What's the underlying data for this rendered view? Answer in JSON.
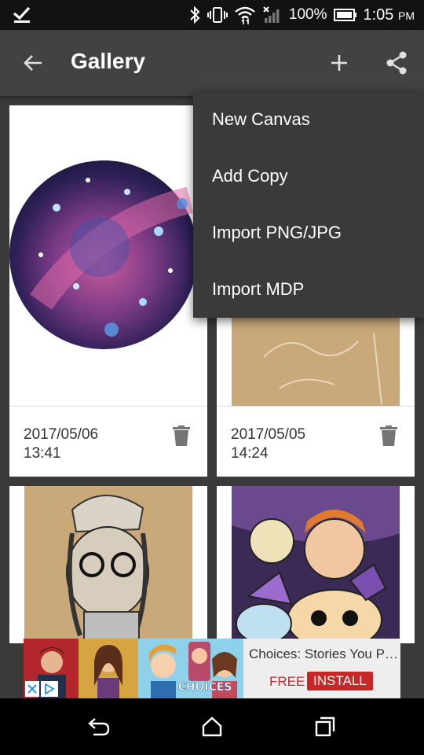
{
  "status_bar": {
    "battery": "100%",
    "time": "1:05",
    "ampm": "PM"
  },
  "app_bar": {
    "title": "Gallery"
  },
  "gallery": {
    "cards": [
      {
        "date": "2017/05/06",
        "time": "13:41"
      },
      {
        "date": "2017/05/05",
        "time": "14:24"
      },
      {
        "date": "",
        "time": ""
      },
      {
        "date": "",
        "time": ""
      }
    ]
  },
  "menu": {
    "items": [
      {
        "label": "New Canvas"
      },
      {
        "label": "Add Copy"
      },
      {
        "label": "Import PNG/JPG"
      },
      {
        "label": "Import MDP"
      }
    ]
  },
  "ad": {
    "title": "Choices: Stories You Play",
    "price": "FREE",
    "cta": "INSTALL",
    "logo_text": "CHOICES"
  },
  "colors": {
    "app_bar": "#424242",
    "background": "#3a3a3a",
    "ad_accent": "#c62828"
  }
}
